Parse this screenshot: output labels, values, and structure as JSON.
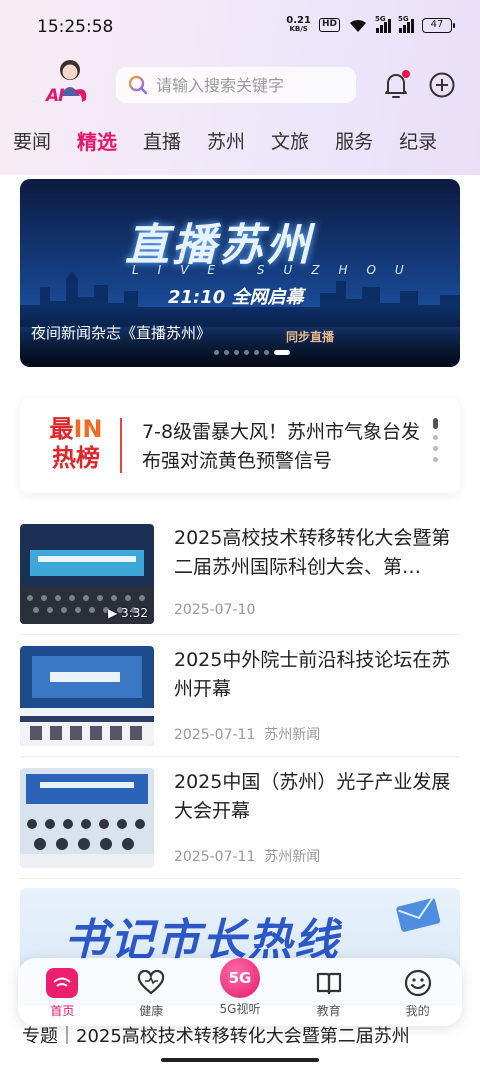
{
  "status_bar": {
    "time": "15:25:58",
    "net_speed": "0.21",
    "net_unit": "KB/S",
    "hd": "HD",
    "sig1": "5G",
    "sig2": "5G",
    "battery": "47"
  },
  "header": {
    "ai_label": "AI",
    "search_placeholder": "请输入搜索关键字",
    "notification_dot": true
  },
  "tabs": [
    {
      "label": "要闻"
    },
    {
      "label": "精选",
      "active": true
    },
    {
      "label": "直播"
    },
    {
      "label": "苏州"
    },
    {
      "label": "文旅"
    },
    {
      "label": "服务"
    },
    {
      "label": "纪录"
    }
  ],
  "banner": {
    "title": "直播苏州",
    "subtitle": "LIVE SUZHOU",
    "time_text": "21:10 全网启幕",
    "sync_text": "同步直播",
    "caption": "夜间新闻杂志《直播苏州》",
    "slides_total": 7,
    "active_slide": 7
  },
  "hot": {
    "logo_line1_a": "最",
    "logo_line1_b": "IN",
    "logo_line2": "热榜",
    "headline": "7-8级雷暴大风！苏州市气象台发布强对流黄色预警信号"
  },
  "news": [
    {
      "title": "2025高校技术转移转化大会暨第二届苏州国际科创大会、第…",
      "meta": "2025-07-10",
      "duration": "▶ 3:32"
    },
    {
      "title": "2025中外院士前沿科技论坛在苏州开幕",
      "meta": "2025-07-11  苏州新闻"
    },
    {
      "title": "2025中国（苏州）光子产业发展大会开幕",
      "meta": "2025-07-11  苏州新闻"
    }
  ],
  "promo": {
    "text": "书记市长热线",
    "special": "专题｜2025高校技术转移转化大会暨第二届苏州"
  },
  "bottom_nav": [
    {
      "label": "首页",
      "icon": "home-icon",
      "active": true
    },
    {
      "label": "健康",
      "icon": "heart-icon"
    },
    {
      "label": "5G视听",
      "icon": "fiveg-icon",
      "badge": "5G"
    },
    {
      "label": "教育",
      "icon": "book-icon"
    },
    {
      "label": "我的",
      "icon": "smile-icon"
    }
  ],
  "colors": {
    "accent": "#e8176b",
    "hot_red": "#e0262b",
    "muted": "#999999"
  }
}
